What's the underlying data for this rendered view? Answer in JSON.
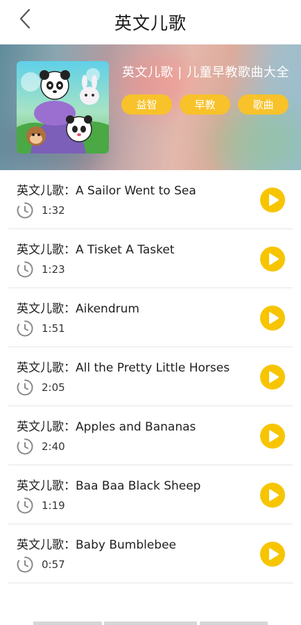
{
  "header": {
    "title": "英文儿歌"
  },
  "album": {
    "title": "英文儿歌 | 儿童早教歌曲大全",
    "tags": [
      "益智",
      "早教",
      "歌曲"
    ]
  },
  "songs": [
    {
      "title": "英文儿歌：A Sailor Went to Sea",
      "duration": "1:32"
    },
    {
      "title": "英文儿歌：A Tisket A Tasket",
      "duration": "1:23"
    },
    {
      "title": "英文儿歌：Aikendrum",
      "duration": "1:51"
    },
    {
      "title": "英文儿歌：All the Pretty Little Horses",
      "duration": "2:05"
    },
    {
      "title": "英文儿歌：Apples and Bananas",
      "duration": "2:40"
    },
    {
      "title": "英文儿歌：Baa Baa Black Sheep",
      "duration": "1:19"
    },
    {
      "title": "英文儿歌：Baby Bumblebee",
      "duration": "0:57"
    }
  ],
  "icons": {
    "back": "chevron-left-icon",
    "clock": "clock-icon",
    "play": "play-icon"
  },
  "colors": {
    "accent": "#f7c22a",
    "play": "#f7c500"
  }
}
